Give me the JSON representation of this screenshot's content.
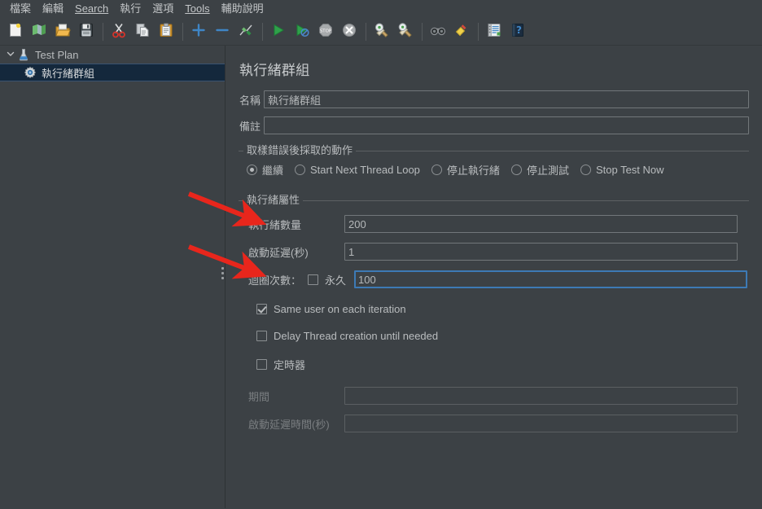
{
  "menubar": {
    "items": [
      {
        "label": "檔案",
        "mnemonic": ""
      },
      {
        "label": "編輯",
        "mnemonic": ""
      },
      {
        "label": "Search",
        "mnemonic": "S"
      },
      {
        "label": "執行",
        "mnemonic": ""
      },
      {
        "label": "選項",
        "mnemonic": ""
      },
      {
        "label": "Tools",
        "mnemonic": "T"
      },
      {
        "label": "輔助說明",
        "mnemonic": ""
      }
    ]
  },
  "toolbar": {
    "buttons": [
      {
        "name": "new-icon",
        "tooltip": "New"
      },
      {
        "name": "templates-icon",
        "tooltip": "Templates"
      },
      {
        "name": "open-icon",
        "tooltip": "Open"
      },
      {
        "name": "save-icon",
        "tooltip": "Save"
      },
      {
        "name": "cut-icon",
        "tooltip": "Cut"
      },
      {
        "name": "copy-icon",
        "tooltip": "Copy"
      },
      {
        "name": "paste-icon",
        "tooltip": "Paste"
      },
      {
        "name": "expand-all-icon",
        "tooltip": "Expand All"
      },
      {
        "name": "collapse-all-icon",
        "tooltip": "Collapse All"
      },
      {
        "name": "toggle-icon",
        "tooltip": "Toggle"
      },
      {
        "name": "start-icon",
        "tooltip": "Start"
      },
      {
        "name": "start-no-pauses-icon",
        "tooltip": "Start no pauses"
      },
      {
        "name": "stop-icon",
        "tooltip": "Stop"
      },
      {
        "name": "shutdown-icon",
        "tooltip": "Shutdown"
      },
      {
        "name": "clear-icon",
        "tooltip": "Clear"
      },
      {
        "name": "clear-all-icon",
        "tooltip": "Clear All"
      },
      {
        "name": "search-icon",
        "tooltip": "Search"
      },
      {
        "name": "reset-search-icon",
        "tooltip": "Reset Search"
      },
      {
        "name": "function-helper-icon",
        "tooltip": "Function Helper Dialog"
      },
      {
        "name": "help-icon",
        "tooltip": "Help"
      }
    ]
  },
  "tree": {
    "nodes": [
      {
        "label": "Test Plan",
        "icon": "test-plan-icon",
        "expanded": true,
        "selected": false
      },
      {
        "label": "執行緒群組",
        "icon": "thread-group-icon",
        "expanded": false,
        "selected": true
      }
    ]
  },
  "panel": {
    "title": "執行緒群組",
    "name_label": "名稱",
    "name_value": "執行緒群組",
    "comments_label": "備註",
    "comments_value": "",
    "error_action": {
      "group_title": "取樣錯誤後採取的動作",
      "options": [
        {
          "label": "繼續",
          "selected": true
        },
        {
          "label": "Start Next Thread Loop",
          "selected": false
        },
        {
          "label": "停止執行緒",
          "selected": false
        },
        {
          "label": "停止測試",
          "selected": false
        },
        {
          "label": "Stop Test Now",
          "selected": false
        }
      ]
    },
    "thread_properties": {
      "group_title": "執行緒屬性",
      "threads_label": "執行緒數量",
      "threads_value": "200",
      "rampup_label": "啟動延遲(秒)",
      "rampup_value": "1",
      "loop_label": "迴圈次數：",
      "forever_label": "永久",
      "forever_checked": false,
      "loop_value": "100",
      "same_user_label": "Same user on each iteration",
      "same_user_checked": true,
      "delay_thread_label": "Delay Thread creation until needed",
      "delay_thread_checked": false,
      "scheduler_label": "定時器",
      "scheduler_checked": false,
      "duration_label": "期間",
      "duration_value": "",
      "startup_delay_label": "啟動延遲時間(秒)",
      "startup_delay_value": ""
    }
  },
  "annotations": {
    "arrow_color": "#e8261c",
    "arrows": [
      {
        "name": "arrow-threads",
        "target": "執行緒數量"
      },
      {
        "name": "arrow-loop-count",
        "target": "迴圈次數："
      }
    ]
  },
  "colors": {
    "background": "#3c4145",
    "selection": "#14283c",
    "focus_border": "#3d7ab5",
    "text": "#b9bcbe"
  }
}
